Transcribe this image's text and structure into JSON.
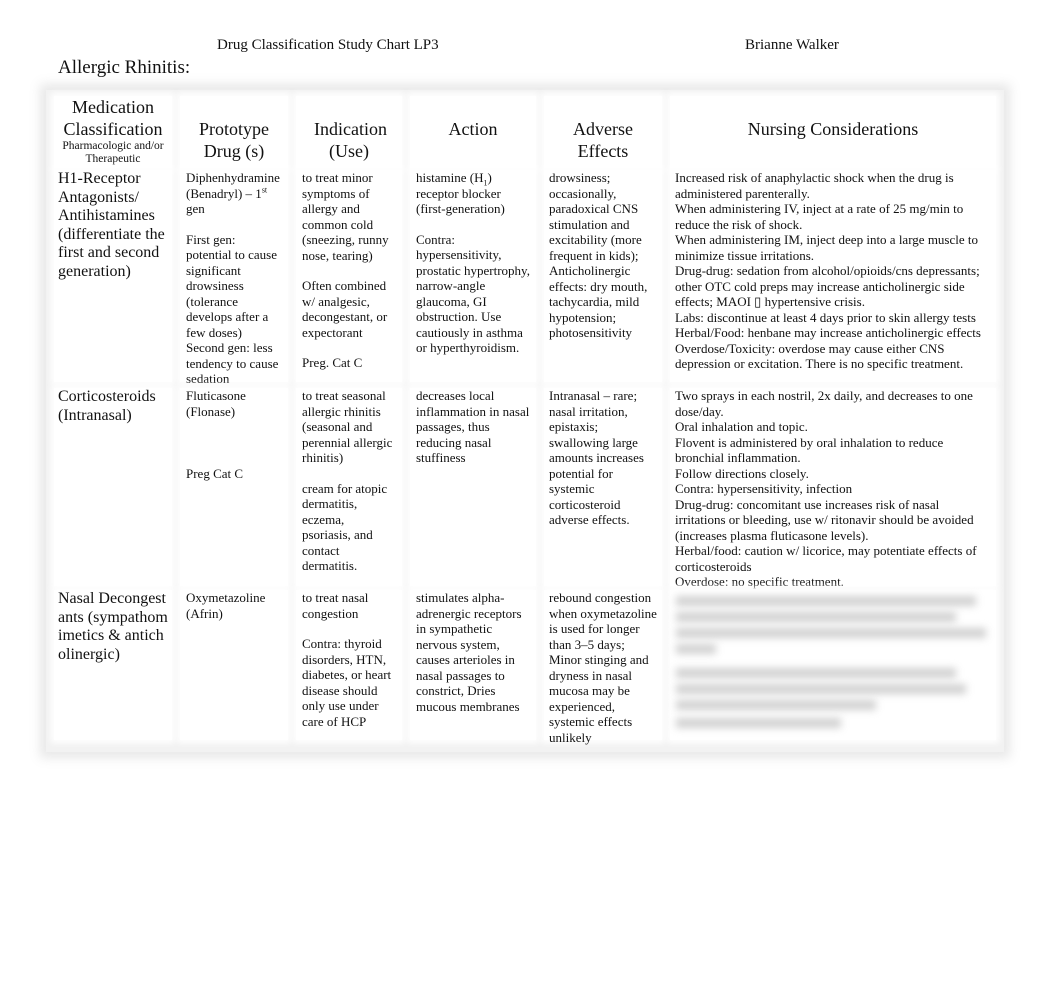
{
  "document": {
    "title": "Drug Classification Study Chart LP3",
    "author": "Brianne Walker",
    "section": "Allergic Rhinitis:"
  },
  "table": {
    "headers": {
      "classification": "Medication Classification",
      "classification_sub": "Pharmacologic and/or Therapeutic",
      "prototype": "Prototype Drug (s)",
      "indication": "Indication (Use)",
      "action": "Action",
      "adverse": "Adverse Effects",
      "nursing": "Nursing Considerations"
    },
    "rows": [
      {
        "classification": "H1-Receptor Antagonists/ Antihistamines (differentiate the first and second generation)",
        "prototype": {
          "drug": "Diphenhydramine (Benadryl) – 1",
          "drug_sup": "st",
          "drug_tail": " gen",
          "notes": "First gen: potential to cause significant drowsiness (tolerance develops after a few doses)\nSecond gen: less tendency to cause sedation"
        },
        "indication": {
          "use": "to treat minor symptoms of allergy and common cold (sneezing, runny nose, tearing)",
          "note": "Often combined w/ analgesic, decongestant, or expectorant",
          "preg": "Preg. Cat C"
        },
        "action": {
          "main_pre": "histamine (H",
          "main_sub": "1",
          "main_post": ") receptor blocker (first-generation)",
          "contra": "Contra: hypersensitivity, prostatic hypertrophy, narrow-angle glaucoma, GI obstruction. Use cautiously in asthma or hyperthyroidism."
        },
        "adverse": "drowsiness; occasionally, paradoxical CNS stimulation and excitability (more frequent in kids); Anticholinergic effects: dry mouth, tachycardia, mild hypotension; photosensitivity",
        "nursing": [
          "Increased risk of anaphylactic shock when the drug is administered parenterally.",
          "When administering IV, inject at a rate of 25 mg/min to reduce the risk of shock.",
          "When administering IM, inject deep into a large muscle to minimize tissue irritations.",
          "Drug-drug: sedation from alcohol/opioids/cns depressants; other OTC cold preps may increase anticholinergic side effects; MAOI ▯ hypertensive crisis.",
          "Labs: discontinue at least 4 days prior to skin allergy tests",
          "Herbal/Food: henbane may increase anticholinergic effects",
          "Overdose/Toxicity: overdose may cause either CNS depression or excitation. There is no specific treatment."
        ]
      },
      {
        "classification": "Corticosteroids (Intranasal)",
        "prototype": {
          "drug": "Fluticasone (Flonase)",
          "preg": "Preg Cat C"
        },
        "indication": {
          "use": "to treat seasonal allergic rhinitis (seasonal and perennial allergic rhinitis)",
          "note": "cream for atopic dermatitis, eczema, psoriasis, and contact dermatitis."
        },
        "action": "decreases local inflammation in nasal passages, thus reducing nasal stuffiness",
        "adverse": "Intranasal – rare; nasal irritation, epistaxis; swallowing large amounts increases potential for systemic corticosteroid adverse effects.",
        "nursing": [
          "Two sprays in each nostril, 2x daily, and decreases to one dose/day.",
          "Oral inhalation and topic.",
          "Flovent is administered by oral inhalation to reduce bronchial inflammation.",
          "Follow directions closely.",
          "Contra: hypersensitivity, infection",
          "Drug-drug: concomitant use increases risk of nasal irritations or bleeding, use w/ ritonavir should be avoided (increases plasma fluticasone levels).",
          "Herbal/food: caution w/ licorice, may potentiate effects of corticosteroids",
          "Overdose: no specific treatment."
        ]
      },
      {
        "classification": "Nasal Decongestants (sympathomimetics & anticholinergic)",
        "prototype": {
          "drug": "Oxymetazoline (Afrin)"
        },
        "indication": {
          "use": "to treat nasal congestion",
          "note": "Contra: thyroid disorders, HTN, diabetes, or heart disease should only use under care of HCP"
        },
        "action": "stimulates alpha-adrenergic receptors in sympathetic nervous system, causes arterioles in nasal passages to constrict, Dries mucous membranes",
        "adverse": "rebound congestion when oxymetazoline is used for longer than 3–5 days; Minor stinging and dryness in nasal mucosa may be experienced, systemic effects unlikely",
        "nursing_blurred": true
      }
    ]
  }
}
